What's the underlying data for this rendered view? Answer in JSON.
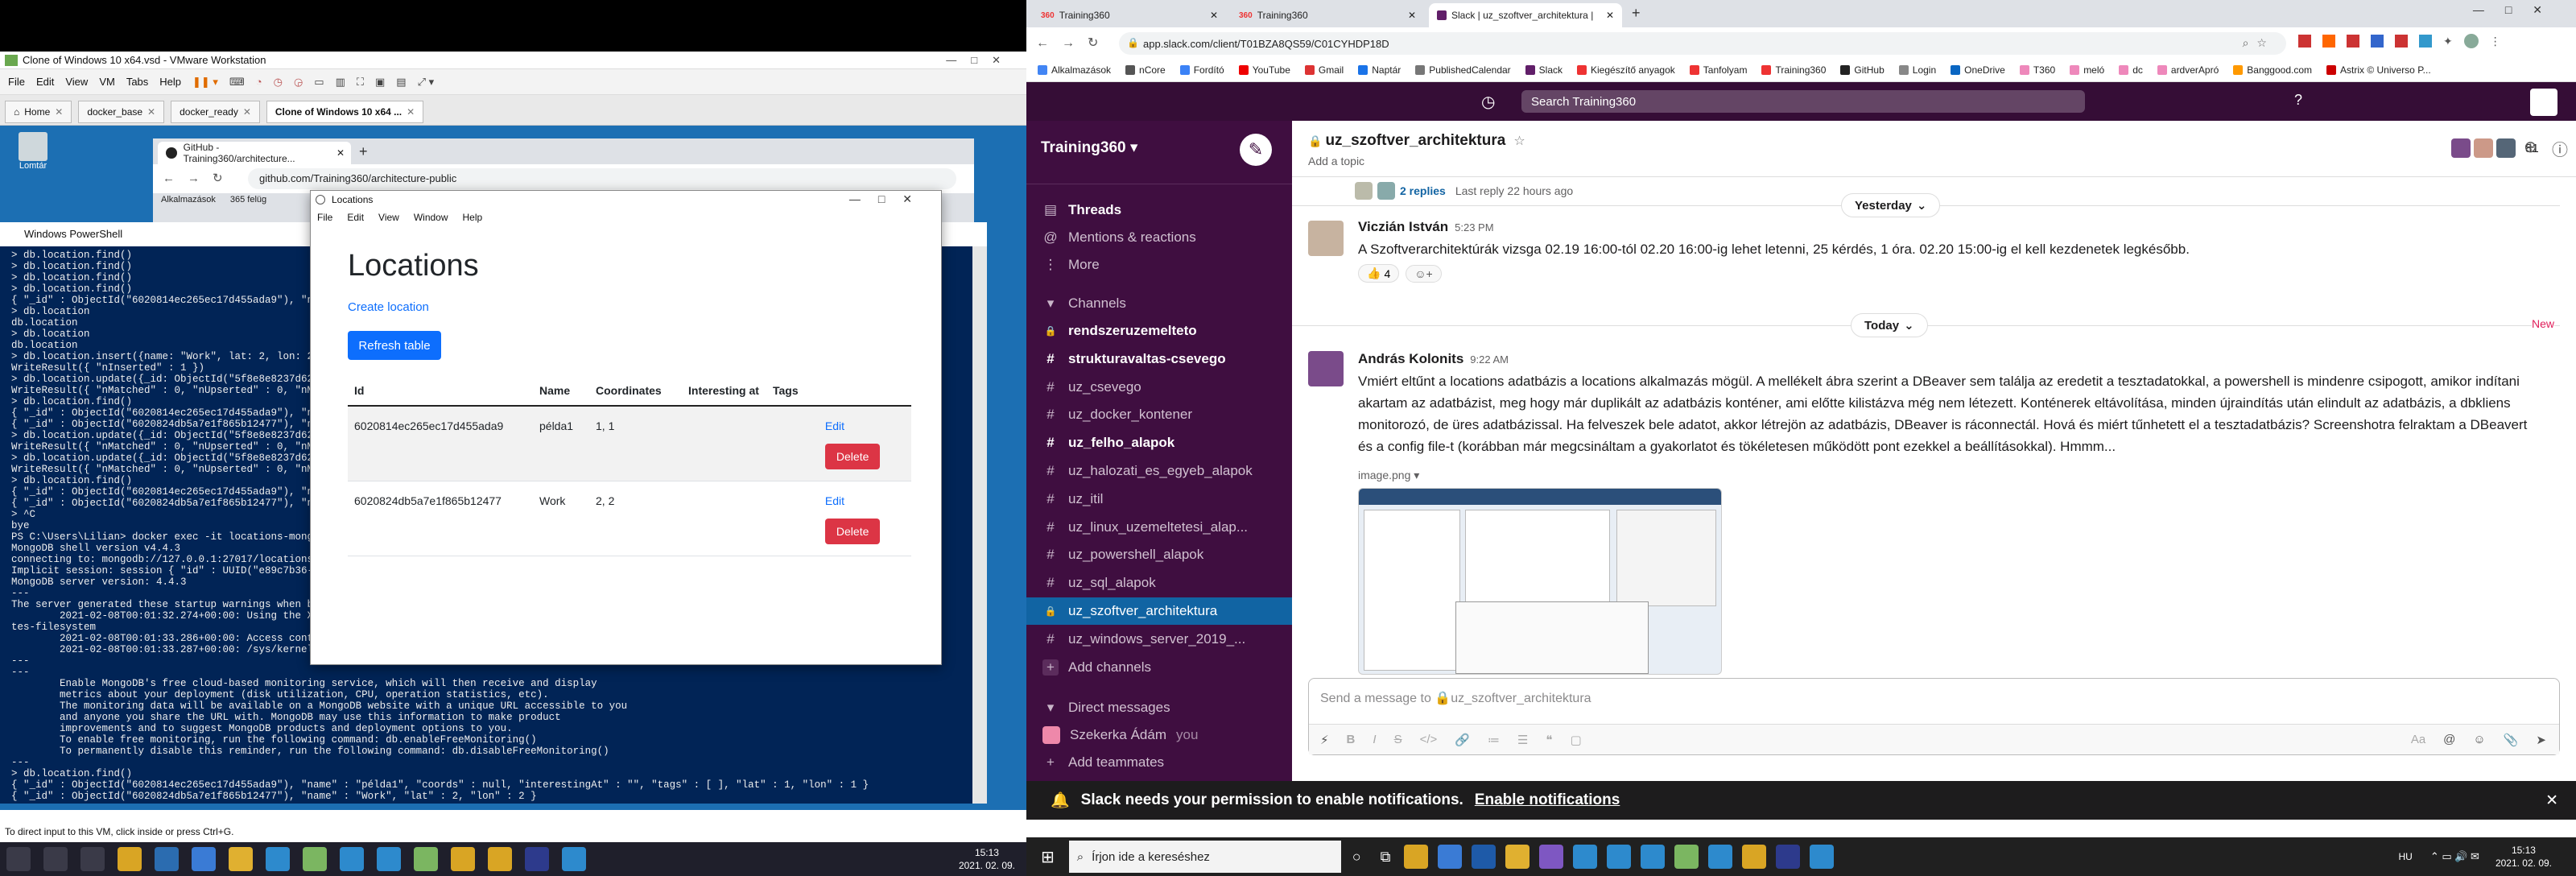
{
  "vmware": {
    "title": "Clone of Windows 10 x64.vsd - VMware Workstation",
    "menu": [
      "File",
      "Edit",
      "View",
      "VM",
      "Tabs",
      "Help"
    ],
    "tabs": [
      "Home",
      "docker_base",
      "docker_ready",
      "Clone of Windows 10 x64 ..."
    ],
    "status": "To direct input to this VM, click inside or press Ctrl+G.",
    "desktop_icon_label": "Lomtár",
    "clock_time": "15:13",
    "clock_date": "2021. 02. 09."
  },
  "guest_chrome": {
    "tab_title": "GitHub - Training360/architecture...",
    "url": "github.com/Training360/architecture-public",
    "bookmarks": [
      "Alkalmazások",
      "365 felüg"
    ]
  },
  "powershell": {
    "title": "Windows PowerShell",
    "lines": [
      "> db.location.find()",
      "> db.location.find()",
      "> db.location.find()",
      "> db.location.find()",
      "{ \"_id\" : ObjectId(\"6020814ec265ec17d455ada9\"), \"name",
      "> db.location",
      "db.location",
      "> db.location",
      "db.location",
      "> db.location.insert({name: \"Work\", lat: 2, lon: 2})",
      "WriteResult({ \"nInserted\" : 1 })",
      "> db.location.update({_id: ObjectId(\"5f8e8e8237d621",
      "WriteResult({ \"nMatched\" : 0, \"nUpserted\" : 0, \"nModi",
      "> db.location.find()",
      "{ \"_id\" : ObjectId(\"6020814ec265ec17d455ada9\"), \"name",
      "{ \"_id\" : ObjectId(\"6020824db5a7e1f865b12477\"), \"name",
      "> db.location.update({_id: ObjectId(\"5f8e8e8237d621",
      "WriteResult({ \"nMatched\" : 0, \"nUpserted\" : 0, \"nModi",
      "> db.location.update({_id: ObjectId(\"5f8e8e8237d621",
      "WriteResult({ \"nMatched\" : 0, \"nUpserted\" : 0, \"nModi",
      "> db.location.find()",
      "{ \"_id\" : ObjectId(\"6020814ec265ec17d455ada9\"), \"name",
      "{ \"_id\" : ObjectId(\"6020824db5a7e1f865b12477\"), \"name",
      "> ^C",
      "bye",
      "PS C:\\Users\\Lilian> docker exec -it locations-mongo m",
      "MongoDB shell version v4.4.3",
      "connecting to: mongodb://127.0.0.1:27017/locations?co",
      "Implicit session: session { \"id\" : UUID(\"e89c7b36-e2d",
      "MongoDB server version: 4.4.3",
      "---",
      "The server generated these startup warnings when boot",
      "        2021-02-08T00:01:32.274+00:00: Using the XFS",
      "tes-filesystem",
      "        2021-02-08T00:01:33.286+00:00: Access control",
      "        2021-02-08T00:01:33.287+00:00: /sys/kernel/mm",
      "---",
      "---",
      "        Enable MongoDB's free cloud-based monitoring service, which will then receive and display",
      "        metrics about your deployment (disk utilization, CPU, operation statistics, etc).",
      "",
      "        The monitoring data will be available on a MongoDB website with a unique URL accessible to you",
      "        and anyone you share the URL with. MongoDB may use this information to make product",
      "        improvements and to suggest MongoDB products and deployment options to you.",
      "",
      "        To enable free monitoring, run the following command: db.enableFreeMonitoring()",
      "        To permanently disable this reminder, run the following command: db.disableFreeMonitoring()",
      "---",
      "> db.location.find()",
      "{ \"_id\" : ObjectId(\"6020814ec265ec17d455ada9\"), \"name\" : \"példa1\", \"coords\" : null, \"interestingAt\" : \"\", \"tags\" : [ ], \"lat\" : 1, \"lon\" : 1 }",
      "{ \"_id\" : ObjectId(\"6020824db5a7e1f865b12477\"), \"name\" : \"Work\", \"lat\" : 2, \"lon\" : 2 }",
      "> "
    ]
  },
  "locations_app": {
    "window_title": "Locations",
    "menu": [
      "File",
      "Edit",
      "View",
      "Window",
      "Help"
    ],
    "heading": "Locations",
    "create_link": "Create location",
    "refresh_button": "Refresh table",
    "columns": [
      "Id",
      "Name",
      "Coordinates",
      "Interesting at",
      "Tags"
    ],
    "rows": [
      {
        "id": "6020814ec265ec17d455ada9",
        "name": "példa1",
        "coords": "1, 1",
        "interesting": "",
        "tags": "",
        "edit": "Edit",
        "delete": "Delete"
      },
      {
        "id": "6020824db5a7e1f865b12477",
        "name": "Work",
        "coords": "2, 2",
        "interesting": "",
        "tags": "",
        "edit": "Edit",
        "delete": "Delete"
      }
    ]
  },
  "host_chrome": {
    "tabs": [
      "Training360",
      "Training360",
      "Slack | uz_szoftver_architektura |"
    ],
    "url": "app.slack.com/client/T01BZA8QS59/C01CYHDP18D",
    "bookmarks": [
      "Alkalmazások",
      "nCore",
      "Fordító",
      "YouTube",
      "Gmail",
      "Naptár",
      "PublishedCalendar",
      "Slack",
      "Kiegészítő anyagok",
      "Tanfolyam",
      "Training360",
      "GitHub",
      "Login",
      "OneDrive",
      "T360",
      "meló",
      "dc",
      "ardverApró",
      "Banggood.com",
      "Astrix © Universo P..."
    ]
  },
  "slack": {
    "search_placeholder": "Search Training360",
    "workspace": "Training360",
    "nav": [
      "Threads",
      "Mentions & reactions",
      "More"
    ],
    "channels_header": "Channels",
    "channels": [
      {
        "name": "rendszeruzemelteto",
        "bold": true,
        "locked": true
      },
      {
        "name": "strukturavaltas-csevego",
        "bold": true,
        "locked": false
      },
      {
        "name": "uz_csevego",
        "bold": false,
        "locked": false
      },
      {
        "name": "uz_docker_kontener",
        "bold": false,
        "locked": false
      },
      {
        "name": "uz_felho_alapok",
        "bold": true,
        "locked": false
      },
      {
        "name": "uz_halozati_es_egyeb_alapok",
        "bold": false,
        "locked": false
      },
      {
        "name": "uz_itil",
        "bold": false,
        "locked": false
      },
      {
        "name": "uz_linux_uzemeltetesi_alap...",
        "bold": false,
        "locked": false
      },
      {
        "name": "uz_powershell_alapok",
        "bold": false,
        "locked": false
      },
      {
        "name": "uz_sql_alapok",
        "bold": false,
        "locked": false
      },
      {
        "name": "uz_szoftver_architektura",
        "bold": false,
        "locked": true,
        "selected": true
      },
      {
        "name": "uz_windows_server_2019_...",
        "bold": false,
        "locked": false
      }
    ],
    "add_channels": "Add channels",
    "dm_header": "Direct messages",
    "dm_user": "Szekerka Ádám",
    "dm_you": "you",
    "add_teammates": "Add teammates",
    "channel_name": "uz_szoftver_architektura",
    "add_topic": "Add a topic",
    "member_count": "81",
    "replies": "2 replies",
    "last_reply": "Last reply 22 hours ago",
    "yesterday": "Yesterday",
    "today": "Today",
    "new_label": "New",
    "msg1": {
      "author": "Viczián István",
      "time": "5:23 PM",
      "text": "A Szoftverarchitektúrák vizsga 02.19 16:00-tól 02.20 16:00-ig lehet letenni, 25 kérdés, 1 óra. 02.20 15:00-ig el kell kezdenetek legkésőbb.",
      "reaction": "👍",
      "reaction_count": "4"
    },
    "msg2": {
      "author": "András Kolonits",
      "time": "9:22 AM",
      "text": "Vmiért eltűnt a locations adatbázis a locations alkalmazás mögül. A mellékelt ábra szerint a DBeaver sem találja az eredetit a tesztadatokkal, a powershell is mindenre csipogott, amikor indítani akartam az adatbázist, meg hogy már duplikált az adatbázis konténer, ami előtte kilistázva még nem létezett. Konténerek eltávolítása, minden újraindítás után elindult az adatbázis, a dbkliens monitorozó, de üres adatbázissal. Ha felveszek bele adatot, akkor létrejön az adatbázis, DBeaver is ráconnectál. Hová és miért tűnhetett el a tesztadatbázis? Screenshotra felraktam a DBeavert és a config file-t (korábban már megcsináltam a gyakorlatot és tökéletesen működött pont ezekkel a beállításokkal). Hmmm...",
      "attachment": "image.png"
    },
    "composer_placeholder": "Send a message to 🔒uz_szoftver_architektura",
    "notification_text": "Slack needs your permission to enable notifications.",
    "notification_link": "Enable notifications"
  },
  "host_taskbar": {
    "search": "Írjon ide a kereséshez",
    "lang": "HU",
    "time": "15:13",
    "date": "2021. 02. 09."
  }
}
